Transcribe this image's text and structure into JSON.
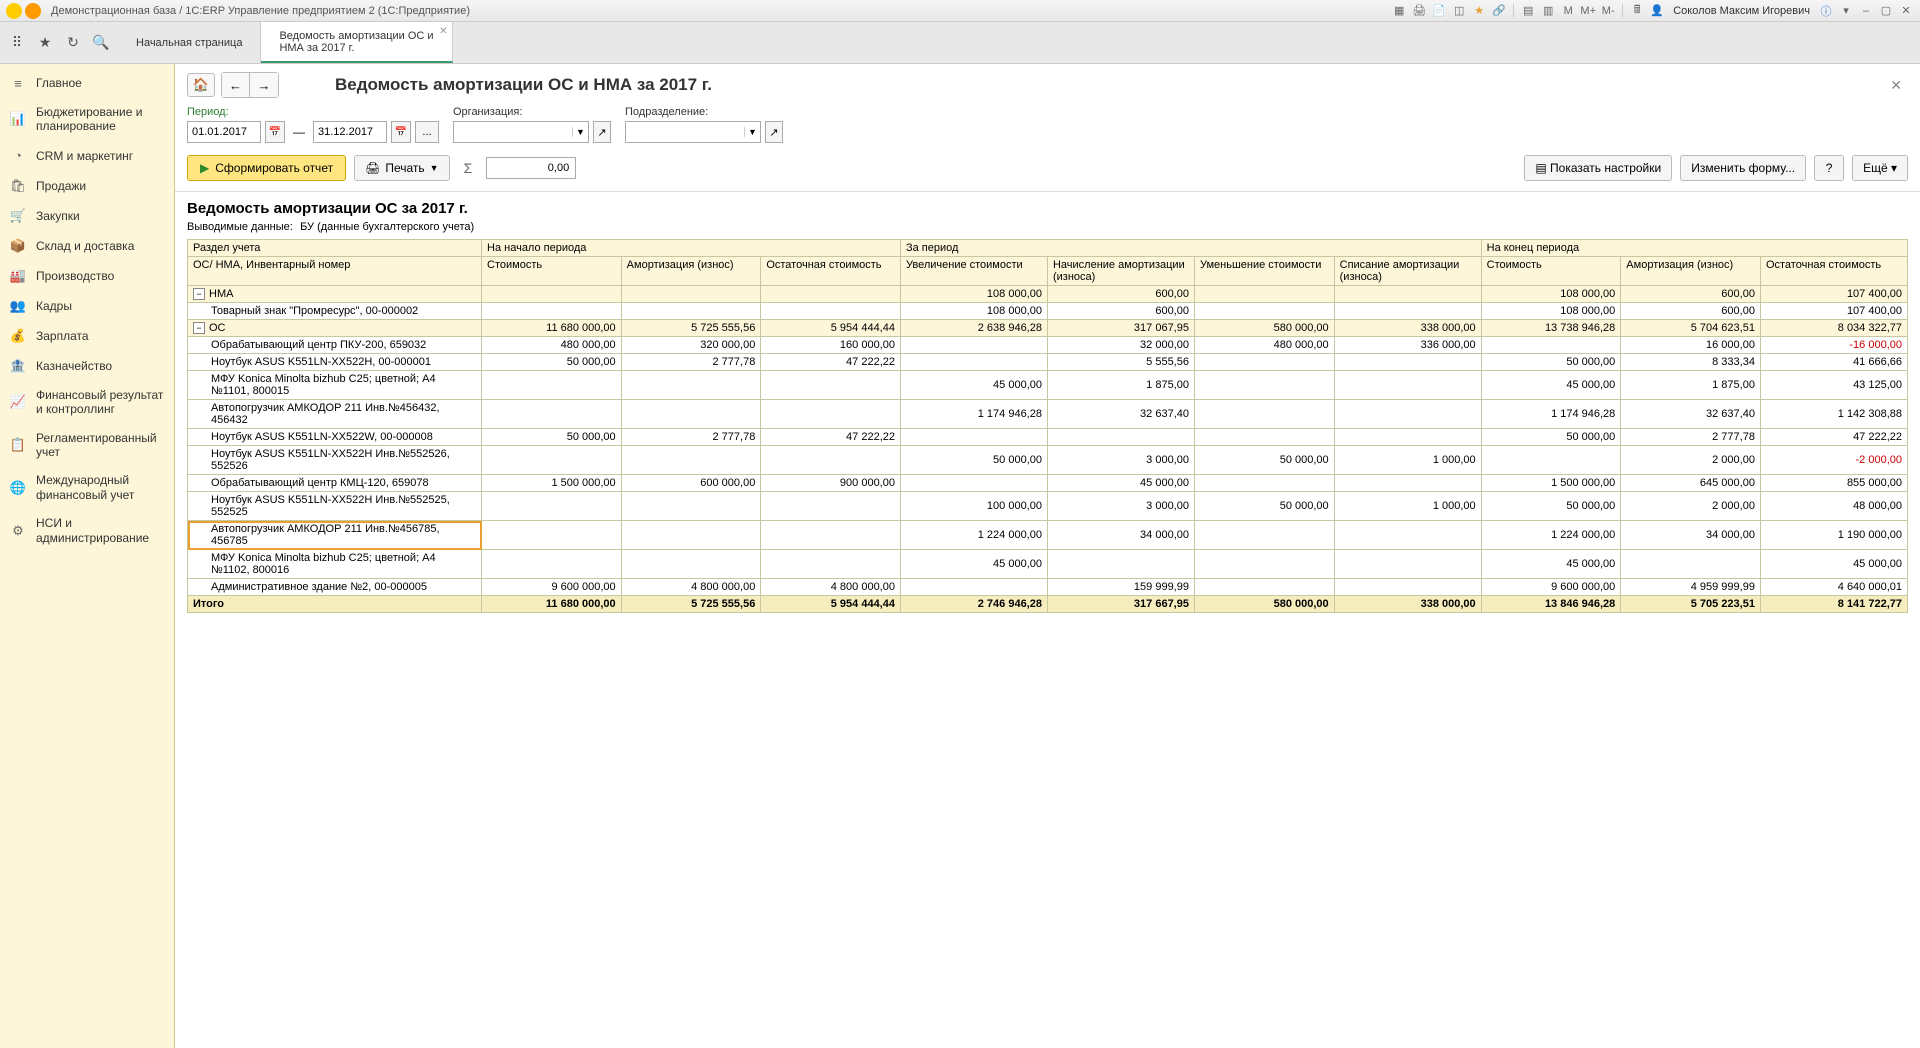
{
  "titlebar": {
    "title": "Демонстрационная база / 1С:ERP Управление предприятием 2  (1С:Предприятие)",
    "user": "Соколов Максим Игоревич",
    "m": "M",
    "m_plus": "M+",
    "m_minus": "M-"
  },
  "tabs": {
    "start": "Начальная страница",
    "active_l1": "Ведомость амортизации ОС и",
    "active_l2": "НМА за 2017 г."
  },
  "sidebar": [
    {
      "icon": "≡",
      "label": "Главное"
    },
    {
      "icon": "📊",
      "label": "Бюджетирование и планирование"
    },
    {
      "icon": "◔",
      "label": "CRM и маркетинг"
    },
    {
      "icon": "🛍",
      "label": "Продажи"
    },
    {
      "icon": "🛒",
      "label": "Закупки"
    },
    {
      "icon": "📦",
      "label": "Склад и доставка"
    },
    {
      "icon": "🏭",
      "label": "Производство"
    },
    {
      "icon": "👥",
      "label": "Кадры"
    },
    {
      "icon": "💰",
      "label": "Зарплата"
    },
    {
      "icon": "🏦",
      "label": "Казначейство"
    },
    {
      "icon": "📈",
      "label": "Финансовый результат и контроллинг"
    },
    {
      "icon": "📋",
      "label": "Регламентированный учет"
    },
    {
      "icon": "🌐",
      "label": "Международный финансовый учет"
    },
    {
      "icon": "⚙",
      "label": "НСИ и администрирование"
    }
  ],
  "page": {
    "title": "Ведомость амортизации ОС и НМА за 2017 г.",
    "period_label": "Период:",
    "date_from": "01.01.2017",
    "date_to": "31.12.2017",
    "org_label": "Организация:",
    "dept_label": "Подразделение:",
    "run": "Сформировать отчет",
    "print": "Печать",
    "sum": "0,00",
    "show_settings": "Показать настройки",
    "edit_form": "Изменить форму...",
    "help": "?",
    "more": "Ещё"
  },
  "report": {
    "title": "Ведомость амортизации ОС за 2017 г.",
    "output_label": "Выводимые данные:",
    "output_val": "БУ (данные бухгалтерского учета)",
    "headers": {
      "section": "Раздел учета",
      "asset": "ОС/ НМА, Инвентарный номер",
      "begin": "На начало периода",
      "during": "За период",
      "end": "На конец периода",
      "cost": "Стоимость",
      "amort": "Амортизация (износ)",
      "residual": "Остаточная стоимость",
      "increase": "Увеличение стоимости",
      "accrual": "Начисление амортизации (износа)",
      "decrease": "Уменьшение стоимости",
      "writeoff": "Списание амортизации (износа)"
    },
    "groups": [
      {
        "name": "НМА",
        "vals": [
          "",
          "",
          "",
          "108 000,00",
          "600,00",
          "",
          "",
          "108 000,00",
          "600,00",
          "107 400,00"
        ],
        "rows": [
          {
            "name": "Товарный знак \"Промресурс\", 00-000002",
            "vals": [
              "",
              "",
              "",
              "108 000,00",
              "600,00",
              "",
              "",
              "108 000,00",
              "600,00",
              "107 400,00"
            ]
          }
        ]
      },
      {
        "name": "ОС",
        "vals": [
          "11 680 000,00",
          "5 725 555,56",
          "5 954 444,44",
          "2 638 946,28",
          "317 067,95",
          "580 000,00",
          "338 000,00",
          "13 738 946,28",
          "5 704 623,51",
          "8 034 322,77"
        ],
        "rows": [
          {
            "name": "Обрабатывающий центр ПКУ-200, 659032",
            "vals": [
              "480 000,00",
              "320 000,00",
              "160 000,00",
              "",
              "32 000,00",
              "480 000,00",
              "336 000,00",
              "",
              "16 000,00",
              "-16 000,00"
            ],
            "neg": [
              9
            ]
          },
          {
            "name": "Ноутбук ASUS K551LN-XX522H, 00-000001",
            "vals": [
              "50 000,00",
              "2 777,78",
              "47 222,22",
              "",
              "5 555,56",
              "",
              "",
              "50 000,00",
              "8 333,34",
              "41 666,66"
            ]
          },
          {
            "name": "МФУ Konica Minolta bizhub C25; цветной; A4  №1101, 800015",
            "vals": [
              "",
              "",
              "",
              "45 000,00",
              "1 875,00",
              "",
              "",
              "45 000,00",
              "1 875,00",
              "43 125,00"
            ]
          },
          {
            "name": "Автопогрузчик АМКОДОР 211 Инв.№456432, 456432",
            "vals": [
              "",
              "",
              "",
              "1 174 946,28",
              "32 637,40",
              "",
              "",
              "1 174 946,28",
              "32 637,40",
              "1 142 308,88"
            ]
          },
          {
            "name": "Ноутбук ASUS K551LN-XX522W, 00-000008",
            "vals": [
              "50 000,00",
              "2 777,78",
              "47 222,22",
              "",
              "",
              "",
              "",
              "50 000,00",
              "2 777,78",
              "47 222,22"
            ]
          },
          {
            "name": "Ноутбук ASUS K551LN-XX522H Инв.№552526, 552526",
            "vals": [
              "",
              "",
              "",
              "50 000,00",
              "3 000,00",
              "50 000,00",
              "1 000,00",
              "",
              "2 000,00",
              "-2 000,00"
            ],
            "neg": [
              9
            ]
          },
          {
            "name": "Обрабатывающий центр КМЦ-120, 659078",
            "vals": [
              "1 500 000,00",
              "600 000,00",
              "900 000,00",
              "",
              "45 000,00",
              "",
              "",
              "1 500 000,00",
              "645 000,00",
              "855 000,00"
            ]
          },
          {
            "name": "Ноутбук ASUS K551LN-XX522H Инв.№552525, 552525",
            "vals": [
              "",
              "",
              "",
              "100 000,00",
              "3 000,00",
              "50 000,00",
              "1 000,00",
              "50 000,00",
              "2 000,00",
              "48 000,00"
            ]
          },
          {
            "name": "Автопогрузчик АМКОДОР 211 Инв.№456785, 456785",
            "vals": [
              "",
              "",
              "",
              "1 224 000,00",
              "34 000,00",
              "",
              "",
              "1 224 000,00",
              "34 000,00",
              "1 190 000,00"
            ],
            "selected": true
          },
          {
            "name": "МФУ Konica Minolta bizhub C25; цветной; A4  №1102, 800016",
            "vals": [
              "",
              "",
              "",
              "45 000,00",
              "",
              "",
              "",
              "45 000,00",
              "",
              "45 000,00"
            ]
          },
          {
            "name": "Административное здание №2, 00-000005",
            "vals": [
              "9 600 000,00",
              "4 800 000,00",
              "4 800 000,00",
              "",
              "159 999,99",
              "",
              "",
              "9 600 000,00",
              "4 959 999,99",
              "4 640 000,01"
            ]
          }
        ]
      }
    ],
    "total_label": "Итого",
    "total": [
      "11 680 000,00",
      "5 725 555,56",
      "5 954 444,44",
      "2 746 946,28",
      "317 667,95",
      "580 000,00",
      "338 000,00",
      "13 846 946,28",
      "5 705 223,51",
      "8 141 722,77"
    ]
  }
}
